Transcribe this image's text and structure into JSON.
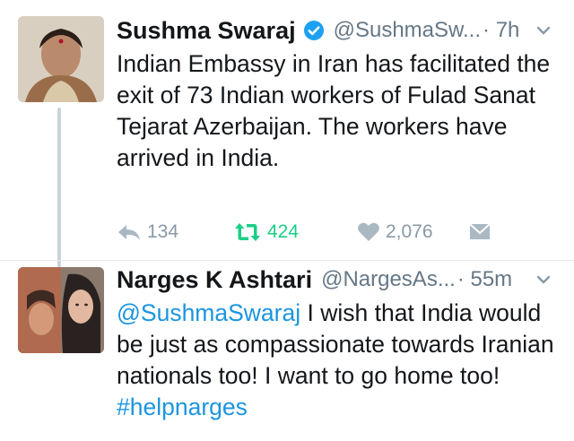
{
  "tweets": [
    {
      "name": "Sushma Swaraj",
      "handle": "@SushmaSw...",
      "time": "· 7h",
      "text": "Indian Embassy in Iran has facilitated the exit of 73 Indian workers of Fulad Sanat Tejarat Azerbaijan. The workers have arrived in India.",
      "replies": "134",
      "retweets": "424",
      "likes": "2,076"
    },
    {
      "name": "Narges K Ashtari",
      "handle": "@NargesAs...",
      "time": "· 55m",
      "mention": "@SushmaSwaraj",
      "text": " I wish that India would be just as compassionate towards Iranian nationals too! I want to go home too! ",
      "hashtag": "#helpnarges",
      "avatar_overlay": "#helpnarges"
    }
  ],
  "colors": {
    "link": "#1b95e0",
    "retweet_active": "#19cf86",
    "verified": "#1da1f2",
    "muted": "#657786"
  }
}
